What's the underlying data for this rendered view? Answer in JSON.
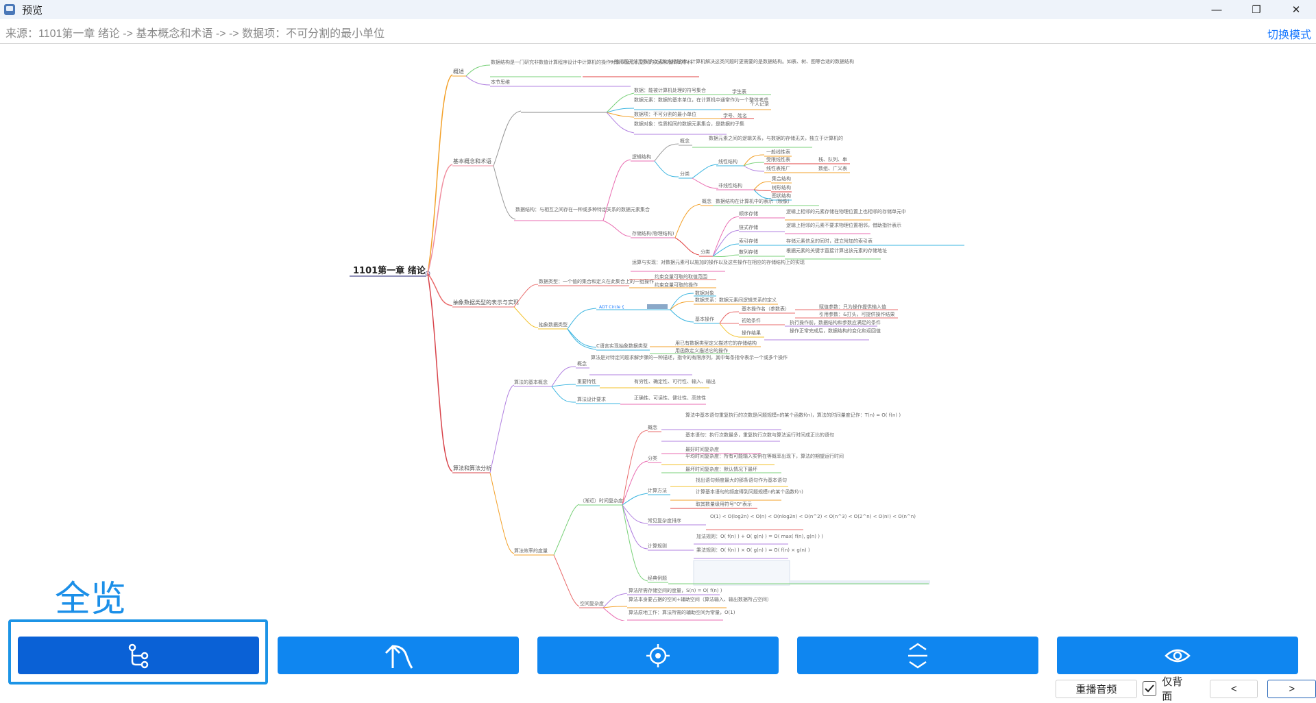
{
  "window": {
    "title": "预览",
    "minimize_glyph": "—",
    "maximize_glyph": "❐",
    "close_glyph": "✕"
  },
  "breadcrumb": {
    "text": "来源：1101第一章 绪论 -> 基本概念和术语 -> -> 数据项：不可分割的最小单位",
    "switch_mode": "切换模式"
  },
  "mindmap": {
    "root": "1101第一章 绪论",
    "branches": [
      {
        "label": "概述",
        "color": "#f3a12a",
        "children": [
          "数据结构是一门研究非数值计算程序设计中计算机的操作对象以及它们之间的关系和操作的学科",
          "一些问题无法用数学公式和方程描述，计算机解决这类问题时更需要的是数据结构。如表、树、图等合适的数据结构",
          "本节思维"
        ]
      },
      {
        "label": "基本概念和术语",
        "color": "#f08fa0",
        "children": [
          "数据：能被计算机处理的符号集合",
          "数据元素：数据的基本单位，在计算机中通常作为一个整体考虑",
          "数据项：不可分割的最小单位",
          "数据对象：性质相同的数据元素集合，是数据的子集",
          "学生表",
          "个人记录",
          "学号、姓名",
          "数据结构：与相互之间存在一种或多种特定关系的数据元素集合",
          "逻辑结构",
          "概念",
          "数据元素之间的逻辑关系，与数据的存储无关，独立于计算机的",
          "分类",
          "线性结构",
          "一般线性表",
          "受限线性表",
          "线性表推广",
          "栈、队列、串",
          "数组、广义表",
          "非线性结构",
          "集合结构",
          "树形结构",
          "图状结构",
          "存储结构(物理结构)",
          "概念",
          "数据结构在计算机中的表示（映像）",
          "分类",
          "顺序存储",
          "逻辑上相邻的元素存储在物理位置上也相邻的存储单元中",
          "链式存储",
          "逻辑上相邻的元素不要求物理位置相邻，借助指针表示",
          "索引存储",
          "存储元素信息的同时，建立附加的索引表",
          "散列存储",
          "根据元素的关键字直接计算出该元素的存储地址",
          "运算与实现：对数据元素可以施加的操作以及这些操作在相应的存储结构上的实现"
        ]
      },
      {
        "label": "抽象数据类型的表示与实现",
        "color": "#e96b6b",
        "children": [
          "数据类型：一个值的集合和定义在此集合上的一组操作",
          "约束变量可取的取值范围",
          "约束变量可取的操作",
          "抽象数据类型",
          "ADT Circle {",
          "数据对象",
          "数据关系：数据元素间逻辑关系的定义",
          "基本操作",
          "基本操作名（参数表）",
          "初始条件",
          "操作结果",
          "赋值参数：只为操作提供输入值",
          "引用参数：&打头，可提供操作结果",
          "执行操作前，数据结构和参数应满足的条件",
          "操作正常完成后，数据结构的变化和返回值",
          "C语言实现抽象数据类型",
          "用已有数据类型定义描述它的存储结构",
          "用函数定义描述它的操作"
        ]
      },
      {
        "label": "算法和算法分析",
        "color": "#d8434a",
        "children": [
          "算法的基本概念",
          "概念",
          "算法是对特定问题求解步骤的一种描述，指令的有限序列，其中每条指令表示一个或多个操作",
          "重要特性",
          "有穷性、确定性、可行性、输入、输出",
          "算法设计要求",
          "正确性、可读性、健壮性、高效性",
          "算法效率的度量",
          "（渐近）时间复杂度",
          "概念",
          "算法中基本语句重复执行的次数是问题规模n的某个函数f(n)，算法的时间量度记作：T(n) = O( f(n) )",
          "基本语句：执行次数最多，重复执行次数与算法运行时间成正比的语句",
          "分类",
          "最好时间复杂度",
          "平均时间复杂度：所有可能输入实例在等概率出现下，算法的期望运行时间",
          "最坏时间复杂度：默认情况下最坏",
          "计算方法",
          "找出语句频度最大的那条语句作为基本语句",
          "计算基本语句的频度得到问题规模n的某个函数f(n)",
          "取其数量级用符号\"O\"表示",
          "常见复杂度排序",
          "O(1) < O(log2n) < O(n) < O(nlog2n) < O(n^2) < O(n^3) < O(2^n) < O(n!) < O(n^n)",
          "计算规则",
          "加法规则：O( f(n) ) + O( g(n) ) = O( max( f(n), g(n) ) )",
          "乘法规则：O( f(n) ) × O( g(n) ) = O( f(n) × g(n) )",
          "经典例题",
          "空间复杂度",
          "算法所需存储空间的度量，S(n) = O( f(n) )",
          "算法本身要占据的空间+辅助空间（算法输入、输出数据所占空间）",
          "算法原地工作：算法所需的辅助空间为常量，O(1)"
        ]
      }
    ]
  },
  "overview_label": "全览",
  "toolbar": [
    {
      "name": "tree-view-button",
      "icon": "tree-branch-icon"
    },
    {
      "name": "go-parent-button",
      "icon": "arrow-up-turn-icon"
    },
    {
      "name": "locate-button",
      "icon": "crosshair-icon"
    },
    {
      "name": "expand-collapse-button",
      "icon": "expand-vertical-icon"
    },
    {
      "name": "show-hide-button",
      "icon": "eye-icon"
    }
  ],
  "bottom": {
    "replay_audio": "重播音频",
    "back_only": "仅背面",
    "back_only_checked": true,
    "prev": "<",
    "next": ">"
  },
  "colors": {
    "accent": "#0f86f0",
    "accent_dark": "#0a61d6",
    "highlight": "#1c94e6"
  }
}
